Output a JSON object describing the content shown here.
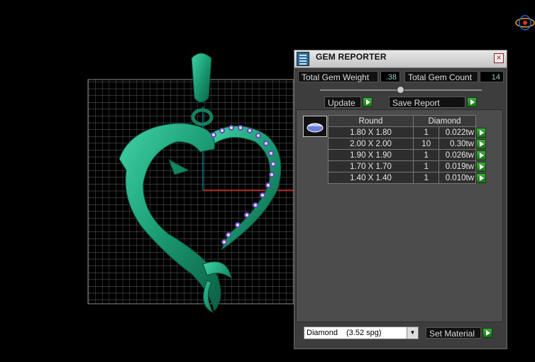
{
  "window": {
    "title": "GEM REPORTER"
  },
  "summary": {
    "weight_label": "Total Gem Weight",
    "weight_value": ".38",
    "count_label": "Total Gem Count",
    "count_value": "14"
  },
  "actions": {
    "update_label": "Update",
    "save_label": "Save Report"
  },
  "table": {
    "headers": [
      "Round",
      "Diamond"
    ],
    "rows": [
      {
        "size": "1.80 X 1.80",
        "qty": "1",
        "weight": "0.022tw"
      },
      {
        "size": "2.00 X 2.00",
        "qty": "10",
        "weight": "0.30tw"
      },
      {
        "size": "1.90 X 1.90",
        "qty": "1",
        "weight": "0.026tw"
      },
      {
        "size": "1.70 X 1.70",
        "qty": "1",
        "weight": "0.019tw"
      },
      {
        "size": "1.40 X 1.40",
        "qty": "1",
        "weight": "0.010tw"
      }
    ]
  },
  "material": {
    "name": "Diamond",
    "spg": "(3.52 spg)",
    "set_label": "Set Material"
  },
  "colors": {
    "model": "#1fa37a",
    "gem": "#7b5cc8",
    "accent_green": "#2e8f2e"
  }
}
